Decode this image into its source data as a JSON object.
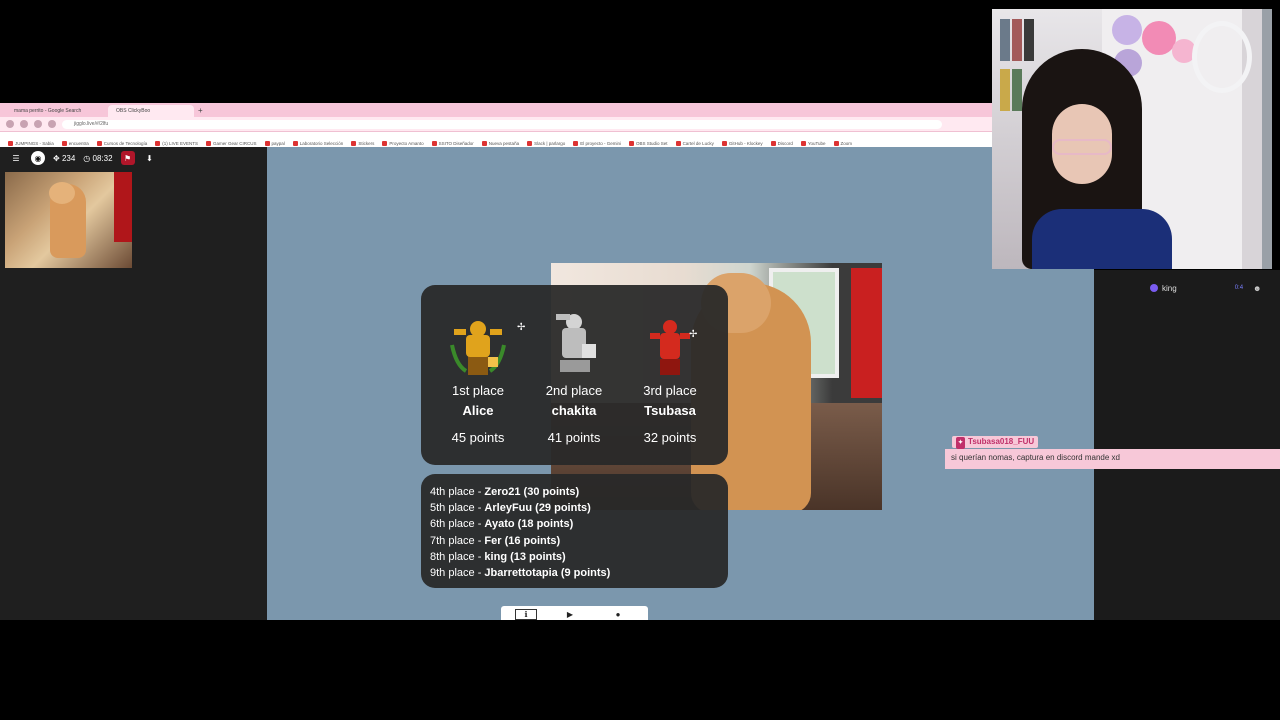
{
  "browser": {
    "tabs": [
      {
        "label": "mama perrito - Google Search"
      },
      {
        "label": "OBS ClickyBoo"
      }
    ],
    "url": "jigglo.live/#/2lfu",
    "bookmarks": [
      "JUMPINGS - Sabia",
      "encuentra",
      "Cursos de Tecnología",
      "(1) LIVE EVENTS",
      "Gamer Gear CIRCUS",
      "paypal",
      "Laboratorio Selección",
      "Stickers",
      "Proyecto Amanto",
      "SSITO Diseñador",
      "Nueva pestaña",
      "Slack | parlargo",
      "El proyecto - Gemini",
      "OBS Studio Set",
      "Cartel de Lucky",
      "GitHub - Klockey",
      "Discord",
      "YouTube",
      "Zoom"
    ]
  },
  "left_panel": {
    "viewers": "234",
    "time": "08:32"
  },
  "podium": {
    "first": {
      "place": "1st place",
      "name": "Alice",
      "points": "45 points",
      "color": "#e0a31c"
    },
    "second": {
      "place": "2nd place",
      "name": "chakita",
      "points": "41 points",
      "color": "#b9b9b9"
    },
    "third": {
      "place": "3rd place",
      "name": "Tsubasa",
      "points": "32 points",
      "color": "#d42a1e"
    }
  },
  "ranking": [
    {
      "place": "4th place - ",
      "entry": "Zero21 (30 points)"
    },
    {
      "place": "5th place - ",
      "entry": "ArleyFuu (29 points)"
    },
    {
      "place": "6th place - ",
      "entry": "Ayato (18 points)"
    },
    {
      "place": "7th place - ",
      "entry": "Fer (16 points)"
    },
    {
      "place": "8th place - ",
      "entry": "king (13 points)"
    },
    {
      "place": "9th place - ",
      "entry": "Jbarrettotapia (9 points)"
    }
  ],
  "chat": {
    "user": "king",
    "user_meta": "0:4",
    "highlight_name": "Tsubasa018_FUU",
    "highlight_message": "si querían nomas, captura en discord mande xd"
  },
  "colors": {
    "stage": "#7b97ad",
    "card": "#282828",
    "tabbar": "#f7c6d9"
  }
}
